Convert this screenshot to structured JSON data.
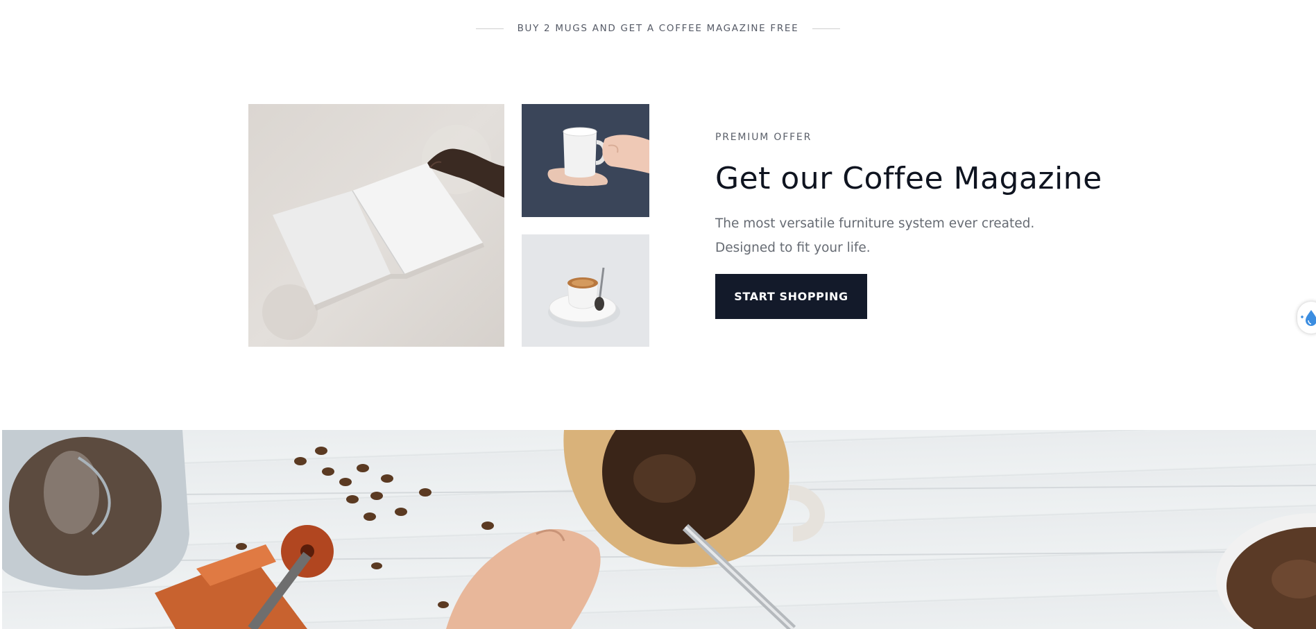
{
  "promo_banner": {
    "text": "BUY 2 MUGS AND GET A COFFEE MAGAZINE FREE"
  },
  "offer": {
    "eyebrow": "PREMIUM OFFER",
    "title": "Get our Coffee Magazine",
    "description_line1": "The most versatile furniture system ever created.",
    "description_line2": "Designed to fit your life.",
    "button_label": "START SHOPPING"
  },
  "images": {
    "magazine": "magazine-photo",
    "mug": "mug-in-hands-photo",
    "espresso": "espresso-cup-photo",
    "hero": "coffee-pour-over-hero-photo"
  },
  "floating_widget": {
    "icon": "water-drop-icon"
  },
  "colors": {
    "button_bg": "#131a2a",
    "heading": "#0f1420",
    "muted_text": "#666b73",
    "drop_blue": "#3b8de0"
  }
}
